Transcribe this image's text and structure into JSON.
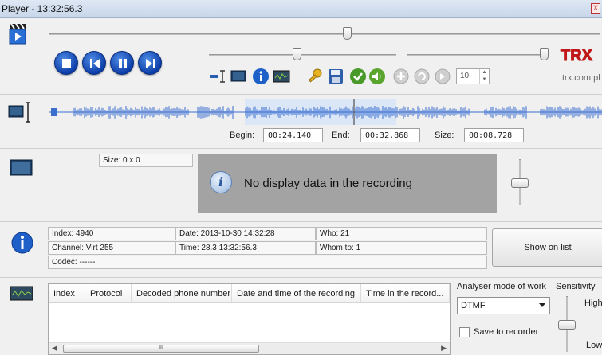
{
  "window": {
    "title": "Player - 13:32:56.3",
    "close_glyph": "X"
  },
  "toolbar": {
    "brand_url": "trx.com.pl",
    "brand_logo": "TRX",
    "speed_value": "10"
  },
  "waveform": {
    "begin_label": "Begin:",
    "begin_value": "00:24.140",
    "end_label": "End:",
    "end_value": "00:32.868",
    "size_label": "Size:",
    "size_value": "00:08.728"
  },
  "display": {
    "size_text": "Size: 0 x 0",
    "message": "No display data in the recording",
    "info_glyph": "i"
  },
  "info": {
    "index": "Index: 4940",
    "date": "Date: 2013-10-30 14:32:28",
    "who": "Who: 21",
    "channel": "Channel: Virt 255",
    "time": "Time: 28.3 13:32:56.3",
    "whom": "Whom to: 1",
    "codec": "Codec: ------",
    "show_on_list": "Show on list"
  },
  "analyser": {
    "columns": [
      "Index",
      "Protocol",
      "Decoded phone number",
      "Date and time of the recording",
      "Time in the record..."
    ],
    "mode_label": "Analyser mode of work",
    "mode_value": "DTMF",
    "sensitivity_label": "Sensitivity",
    "high_label": "High",
    "low_label": "Low",
    "save_label": "Save to recorder",
    "scroll_grip": "III"
  },
  "colors": {
    "accent_blue": "#0d3ea8",
    "panel_gray": "#a3a3a3",
    "brand_red": "#c01818",
    "wave_blue": "#3a6fd0"
  }
}
